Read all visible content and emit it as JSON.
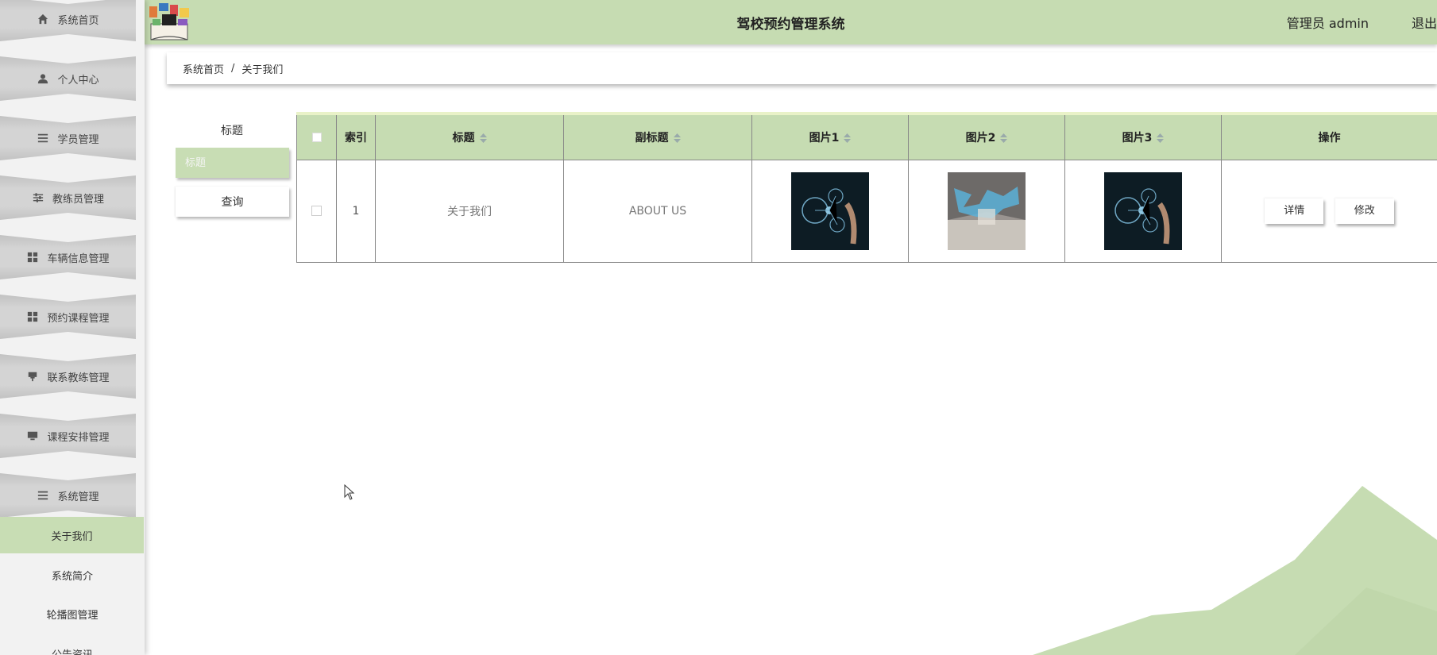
{
  "header": {
    "title": "驾校预约管理系统",
    "user": "管理员 admin",
    "logout": "退出"
  },
  "sidebar": {
    "items": [
      {
        "label": "系统首页",
        "icon": "home-icon"
      },
      {
        "label": "个人中心",
        "icon": "user-icon"
      },
      {
        "label": "学员管理",
        "icon": "list-icon"
      },
      {
        "label": "教练员管理",
        "icon": "sliders-icon"
      },
      {
        "label": "车辆信息管理",
        "icon": "grid-icon"
      },
      {
        "label": "预约课程管理",
        "icon": "grid-icon"
      },
      {
        "label": "联系教练管理",
        "icon": "flag-icon"
      },
      {
        "label": "课程安排管理",
        "icon": "monitor-icon"
      },
      {
        "label": "系统管理",
        "icon": "list-icon"
      }
    ],
    "sub_items": [
      {
        "label": "关于我们",
        "active": true
      },
      {
        "label": "系统简介",
        "active": false
      },
      {
        "label": "轮播图管理",
        "active": false
      },
      {
        "label": "公告资讯",
        "active": false
      }
    ]
  },
  "breadcrumb": {
    "home": "系统首页",
    "separator": "/",
    "current": "关于我们"
  },
  "search": {
    "label": "标题",
    "placeholder": "标题",
    "button": "查询"
  },
  "table": {
    "columns": [
      "",
      "索引",
      "标题",
      "副标题",
      "图片1",
      "图片2",
      "图片3",
      "操作"
    ],
    "rows": [
      {
        "index": "1",
        "title": "关于我们",
        "subtitle": "ABOUT US",
        "actions": {
          "detail": "详情",
          "edit": "修改"
        }
      }
    ]
  },
  "colors": {
    "accent": "#c6dcb2",
    "sidebar_bg": "#f2f2f2",
    "menu_item": "#d0d0d0",
    "active_sub": "#c8ddb4"
  }
}
